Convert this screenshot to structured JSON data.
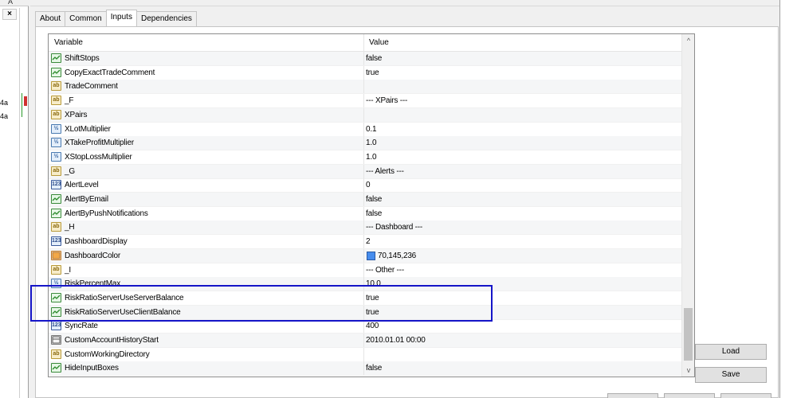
{
  "background": {
    "top_letter": "A",
    "close_glyph": "×",
    "price_labels": [
      "4a",
      "4a"
    ]
  },
  "tabs": [
    {
      "label": "About",
      "active": false
    },
    {
      "label": "Common",
      "active": false
    },
    {
      "label": "Inputs",
      "active": true
    },
    {
      "label": "Dependencies",
      "active": false
    }
  ],
  "grid": {
    "columns": {
      "variable": "Variable",
      "value": "Value"
    },
    "rows": [
      {
        "icon": "bool-icon",
        "name": "ShiftStops",
        "value": "false"
      },
      {
        "icon": "bool-icon",
        "name": "CopyExactTradeComment",
        "value": "true"
      },
      {
        "icon": "string-icon",
        "name": "TradeComment",
        "value": ""
      },
      {
        "icon": "string-icon",
        "name": "_F",
        "value": "--- XPairs ---"
      },
      {
        "icon": "string-icon",
        "name": "XPairs",
        "value": ""
      },
      {
        "icon": "double-icon",
        "name": "XLotMultiplier",
        "value": "0.1"
      },
      {
        "icon": "double-icon",
        "name": "XTakeProfitMultiplier",
        "value": "1.0"
      },
      {
        "icon": "double-icon",
        "name": "XStopLossMultiplier",
        "value": "1.0"
      },
      {
        "icon": "string-icon",
        "name": "_G",
        "value": "--- Alerts ---"
      },
      {
        "icon": "int-icon",
        "name": "AlertLevel",
        "value": "0"
      },
      {
        "icon": "bool-icon",
        "name": "AlertByEmail",
        "value": "false"
      },
      {
        "icon": "bool-icon",
        "name": "AlertByPushNotifications",
        "value": "false"
      },
      {
        "icon": "string-icon",
        "name": "_H",
        "value": "--- Dashboard ---"
      },
      {
        "icon": "int-icon",
        "name": "DashboardDisplay",
        "value": "2"
      },
      {
        "icon": "color-icon",
        "name": "DashboardColor",
        "value": "70,145,236",
        "swatch": "#468ced"
      },
      {
        "icon": "string-icon",
        "name": "_I",
        "value": "--- Other ---"
      },
      {
        "icon": "double-icon",
        "name": "RiskPercentMax",
        "value": "10.0"
      },
      {
        "icon": "bool-icon",
        "name": "RiskRatioServerUseServerBalance",
        "value": "true"
      },
      {
        "icon": "bool-icon",
        "name": "RiskRatioServerUseClientBalance",
        "value": "true"
      },
      {
        "icon": "int-icon",
        "name": "SyncRate",
        "value": "400"
      },
      {
        "icon": "datetime-icon",
        "name": "CustomAccountHistoryStart",
        "value": "2010.01.01 00:00"
      },
      {
        "icon": "string-icon",
        "name": "CustomWorkingDirectory",
        "value": ""
      },
      {
        "icon": "bool-icon",
        "name": "HideInputBoxes",
        "value": "false"
      }
    ]
  },
  "scroll": {
    "up": "^",
    "down": "v"
  },
  "buttons": {
    "load": "Load",
    "save": "Save"
  },
  "colors": {
    "highlight_border": "#1515c8",
    "swatch": "#468ced"
  }
}
